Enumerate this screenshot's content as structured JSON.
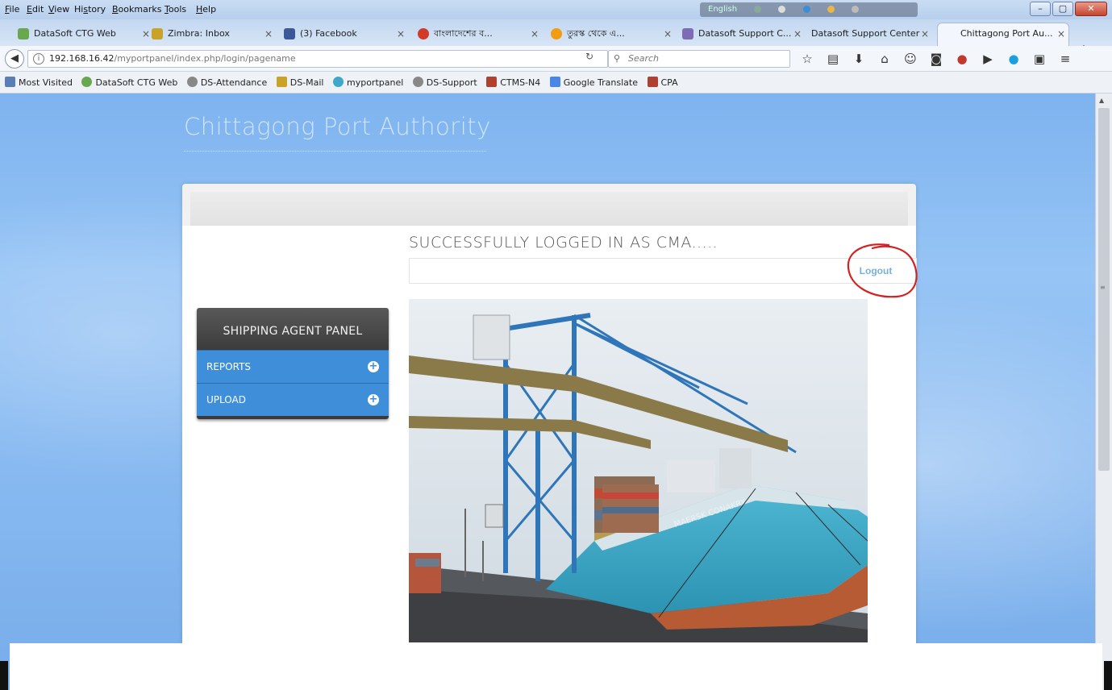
{
  "menu": [
    "File",
    "Edit",
    "View",
    "History",
    "Bookmarks",
    "Tools",
    "Help"
  ],
  "menu_mnemonics": [
    "F",
    "E",
    "V",
    "s",
    "B",
    "T",
    "H"
  ],
  "lang_indicator": "English",
  "tabs": [
    {
      "label": "DataSoft CTG Web",
      "icon_color": "#6aa84f"
    },
    {
      "label": "Zimbra: Inbox",
      "icon_color": "#c9a227"
    },
    {
      "label": "(3) Facebook",
      "icon_color": "#3b5998"
    },
    {
      "label": "বাংলাদেশের ব...",
      "icon_color": "#d13b2a"
    },
    {
      "label": "তুরস্ক থেকে এ...",
      "icon_color": "#f39c12"
    },
    {
      "label": "Datasoft Support C...",
      "icon_color": "#7d6bb5"
    },
    {
      "label": "Datasoft Support Center",
      "icon_color": ""
    },
    {
      "label": "Chittagong Port Au...",
      "icon_color": ""
    }
  ],
  "close_glyph": "×",
  "new_tab_glyph": "+",
  "url": {
    "host": "192.168.16.42",
    "path": "/myportpanel/index.php/login/pagename"
  },
  "search_placeholder": "Search",
  "bookmarks": [
    {
      "label": "Most Visited",
      "icon_color": "#5b7fb5"
    },
    {
      "label": "DataSoft CTG Web",
      "icon_color": "#6aa84f"
    },
    {
      "label": "DS-Attendance",
      "icon_color": "#888"
    },
    {
      "label": "DS-Mail",
      "icon_color": "#c9a227"
    },
    {
      "label": "myportpanel",
      "icon_color": "#3fa7c9"
    },
    {
      "label": "DS-Support",
      "icon_color": "#888"
    },
    {
      "label": "CTMS-N4",
      "icon_color": "#b0402f"
    },
    {
      "label": "Google Translate",
      "icon_color": "#4a86e8"
    },
    {
      "label": "CPA",
      "icon_color": "#b0402f"
    }
  ],
  "site": {
    "title": "Chittagong Port Authority",
    "status_message": "SUCCESSFULLY LOGGED IN AS CMA.....",
    "logout_label": "Logout"
  },
  "sidebar": {
    "header": "SHIPPING AGENT PANEL",
    "items": [
      {
        "label": "REPORTS"
      },
      {
        "label": "UPLOAD"
      }
    ]
  },
  "ship_name": "MAERSK CONAKRY",
  "colors": {
    "accent": "#3f8ed9",
    "panel_header": "#4a4a4a",
    "logout_text": "#7ab0d8",
    "annotation": "#d42020"
  }
}
